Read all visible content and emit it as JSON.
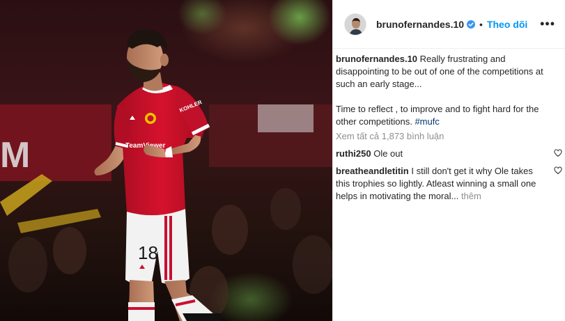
{
  "post": {
    "author": {
      "username": "brunofernandes.10",
      "verified": true,
      "follow_label": "Theo dõi",
      "separator": "•",
      "more_icon": "more-options-icon"
    },
    "caption": {
      "username": "brunofernandes.10",
      "line1": "Really frustrating and disappointing to be out of one of the competitions at such an early stage...",
      "line2_prefix": "Time to reflect , to improve and to fight hard for the other competitions. ",
      "hashtag": "#mufc"
    },
    "view_all_comments": "Xem tất cả 1,873 bình luận",
    "comments": [
      {
        "username": "ruthi250",
        "text": "Ole out",
        "more": ""
      },
      {
        "username": "breatheandletitin",
        "text": "I still don't get it why Ole takes this trophies so lightly. Atleast winning a small one helps in motivating the moral...",
        "more": "thêm"
      }
    ],
    "photo": {
      "shirt_number": "18",
      "shirt_sponsor": "TeamViewer",
      "sleeve_sponsor": "KOHLER",
      "ad_board": "M",
      "colors": {
        "shirt": "#c8102e",
        "shorts": "#f2f2f2",
        "accent": "#0095f6"
      }
    }
  }
}
